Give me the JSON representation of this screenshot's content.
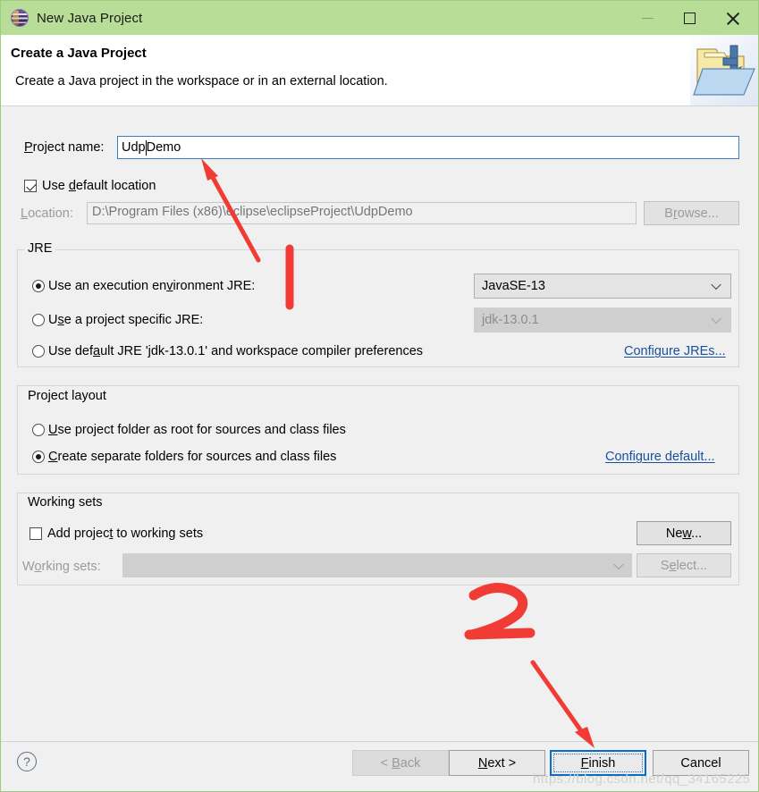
{
  "window": {
    "title": "New Java Project",
    "icon": "eclipse-logo-icon",
    "controls": {
      "minimize": "minimize-icon",
      "maximize": "maximize-icon",
      "close": "close-icon"
    },
    "titlebar_color": "#b7dd97"
  },
  "header": {
    "title": "Create a Java Project",
    "description": "Create a Java project in the workspace or in an external location.",
    "banner_icon": "java-project-folder-icon"
  },
  "project": {
    "name_label": "Project name:",
    "name_value_before_caret": "Udp",
    "name_value_after_caret": "Demo",
    "name_value": "UdpDemo",
    "use_default_location_label": "Use default location",
    "use_default_location_checked": true,
    "location_label": "Location:",
    "location_value": "D:\\Program Files (x86)\\eclipse\\eclipseProject\\UdpDemo",
    "location_enabled": false,
    "browse_label": "Browse...",
    "browse_enabled": false
  },
  "jre": {
    "group_title": "JRE",
    "options": [
      {
        "label": "Use an execution environment JRE:",
        "selected": true
      },
      {
        "label": "Use a project specific JRE:",
        "selected": false
      },
      {
        "label": "Use default JRE 'jdk-13.0.1' and workspace compiler preferences",
        "selected": false
      }
    ],
    "execution_environment_value": "JavaSE-13",
    "execution_environment_enabled": true,
    "project_jre_value": "jdk-13.0.1",
    "project_jre_enabled": false,
    "configure_link": "Configure JREs..."
  },
  "layout": {
    "group_title": "Project layout",
    "options": [
      {
        "label": "Use project folder as root for sources and class files",
        "selected": false
      },
      {
        "label": "Create separate folders for sources and class files",
        "selected": true
      }
    ],
    "configure_link": "Configure default..."
  },
  "working_sets": {
    "group_title": "Working sets",
    "add_checkbox_label": "Add project to working sets",
    "add_checkbox_checked": false,
    "new_label": "New...",
    "sets_label": "Working sets:",
    "sets_value": "",
    "sets_enabled": false,
    "select_label": "Select...",
    "select_enabled": false
  },
  "footer": {
    "help_icon": "help-question-icon",
    "back_label": "< Back",
    "back_enabled": false,
    "next_label": "Next >",
    "next_enabled": true,
    "finish_label": "Finish",
    "finish_focused": true,
    "cancel_label": "Cancel"
  },
  "watermark": "https://blog.csdn.net/qq_34165225",
  "annotations": {
    "color": "#f03c34",
    "marks": [
      {
        "name": "step-1-marker",
        "label": "1",
        "kind": "stroke"
      },
      {
        "name": "step-1-arrow",
        "label": "",
        "kind": "arrow"
      },
      {
        "name": "step-2-marker",
        "label": "2",
        "kind": "stroke"
      },
      {
        "name": "step-2-arrow",
        "label": "",
        "kind": "arrow"
      }
    ]
  }
}
